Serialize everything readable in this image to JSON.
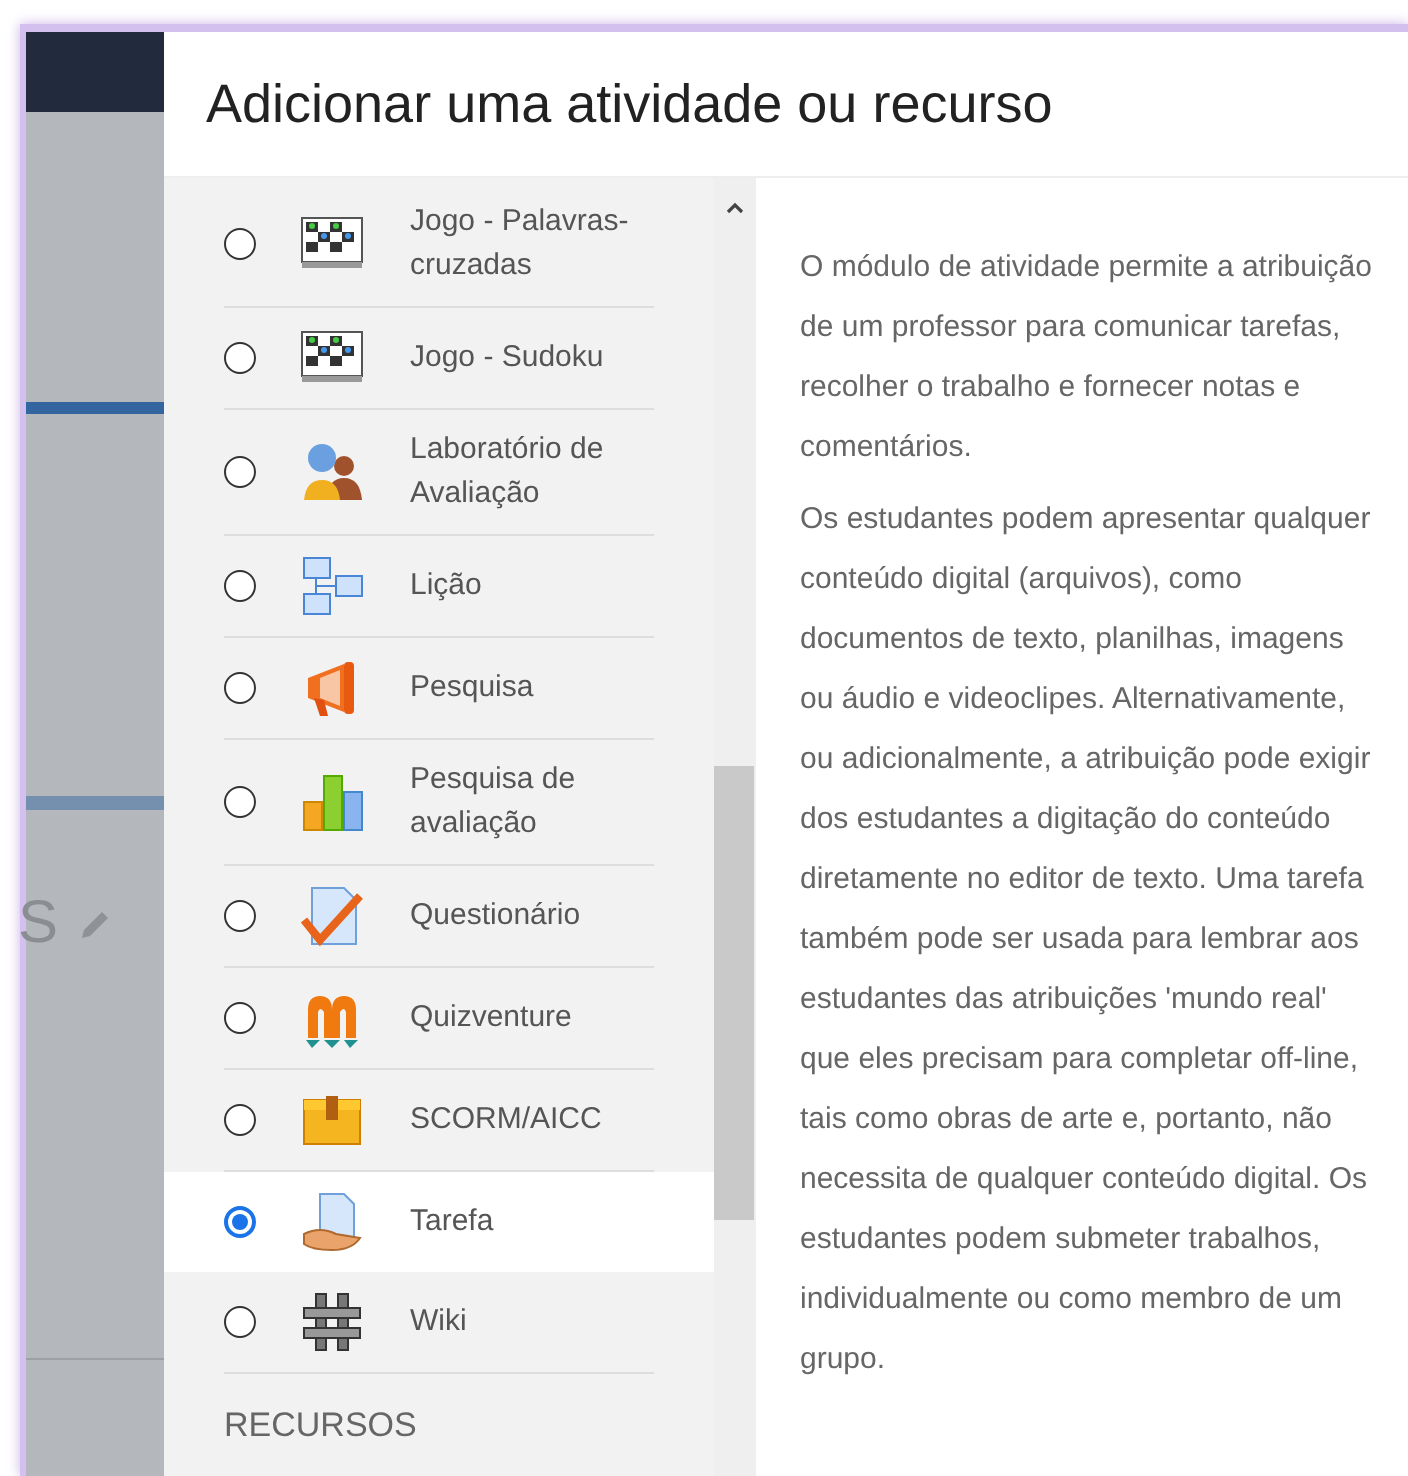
{
  "background_page": {
    "heading_fragment": "S"
  },
  "dialog": {
    "title": "Adicionar uma atividade ou recurso",
    "items": [
      {
        "label": "Jogo - Palavras-cruzadas",
        "selected": false
      },
      {
        "label": "Jogo - Sudoku",
        "selected": false
      },
      {
        "label": "Laboratório de Avaliação",
        "selected": false
      },
      {
        "label": "Lição",
        "selected": false
      },
      {
        "label": "Pesquisa",
        "selected": false
      },
      {
        "label": "Pesquisa de avaliação",
        "selected": false
      },
      {
        "label": "Questionário",
        "selected": false
      },
      {
        "label": "Quizventure",
        "selected": false
      },
      {
        "label": "SCORM/AICC",
        "selected": false
      },
      {
        "label": "Tarefa",
        "selected": true
      },
      {
        "label": "Wiki",
        "selected": false
      }
    ],
    "section_heading": "RECURSOS",
    "description": [
      "O módulo de atividade permite a atribuição de um professor para comunicar tarefas, recolher o trabalho e fornecer notas e comentários.",
      "Os estudantes podem apresentar qualquer conteúdo digital (arquivos), como documentos de texto, planilhas, imagens ou áudio e videoclipes. Alternativamente, ou adicionalmente, a atribuição pode exigir dos estudantes a digitação do conteúdo diretamente no editor de texto. Uma tarefa também pode ser usada para lembrar aos estudantes das atribuições 'mundo real' que eles precisam para completar off-line, tais como obras de arte e, portanto, não necessita de qualquer conteúdo digital. Os estudantes podem submeter trabalhos, individualmente ou como membro de um grupo."
    ]
  }
}
